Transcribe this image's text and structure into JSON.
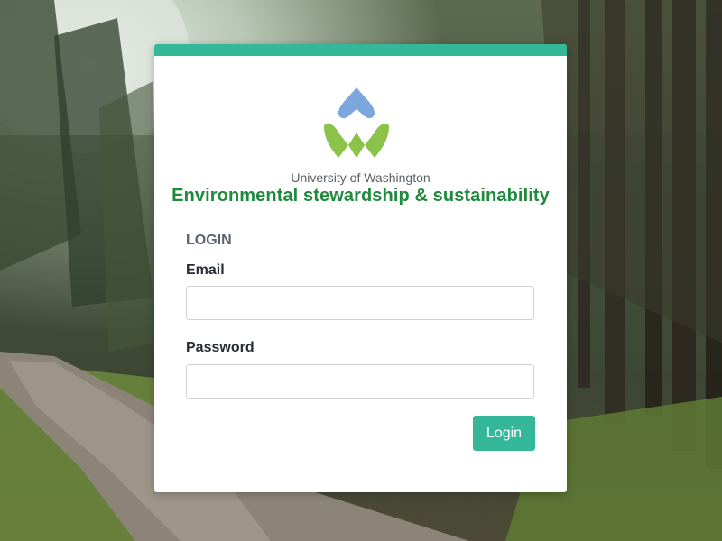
{
  "org_name": "University of Washington",
  "program_title": "Environmental stewardship & sustainability",
  "form": {
    "title": "LOGIN",
    "email_label": "Email",
    "email_value": "",
    "password_label": "Password",
    "password_value": "",
    "submit_label": "Login"
  },
  "logo_icon": "uw-sustainability-logo-icon",
  "colors": {
    "accent": "#35b89a",
    "brand_green": "#1f8a3b",
    "logo_blue": "#7ba7dd",
    "logo_green": "#8bc34a"
  }
}
